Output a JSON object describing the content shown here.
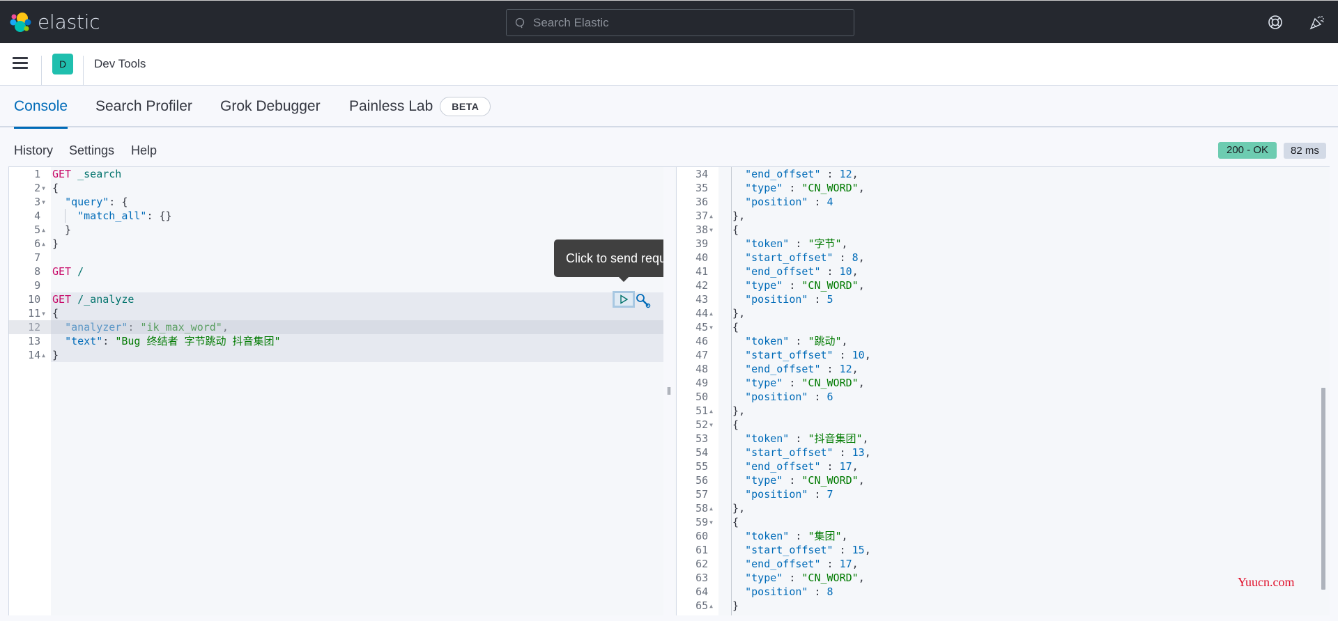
{
  "header": {
    "brand": "elastic",
    "search_placeholder": "Search Elastic",
    "icons": [
      "help-lifebuoy-icon",
      "newsfeed-party-icon"
    ]
  },
  "navbar": {
    "menu_icon": "hamburger-icon",
    "space_initial": "D",
    "app_title": "Dev Tools"
  },
  "tabs": [
    {
      "label": "Console",
      "active": true
    },
    {
      "label": "Search Profiler",
      "active": false
    },
    {
      "label": "Grok Debugger",
      "active": false
    },
    {
      "label": "Painless Lab",
      "active": false,
      "badge": "BETA"
    }
  ],
  "console_toolbar": {
    "history": "History",
    "settings": "Settings",
    "help": "Help",
    "status": "200 - OK",
    "status_color": "#6dccb1",
    "time": "82 ms"
  },
  "tooltip": "Click to send request",
  "editor": {
    "lines": [
      {
        "n": "1",
        "fold": "",
        "tokens": [
          [
            "kw",
            "GET"
          ],
          [
            "pun",
            " "
          ],
          [
            "url",
            "_search"
          ]
        ]
      },
      {
        "n": "2",
        "fold": "down",
        "tokens": [
          [
            "pun",
            "{"
          ]
        ]
      },
      {
        "n": "3",
        "fold": "down",
        "tokens": [
          [
            "pun",
            "  "
          ],
          [
            "key",
            "\"query\""
          ],
          [
            "pun",
            ": {"
          ]
        ]
      },
      {
        "n": "4",
        "fold": "",
        "tokens": [
          [
            "pun",
            "    "
          ],
          [
            "key",
            "\"match_all\""
          ],
          [
            "pun",
            ": {}"
          ]
        ]
      },
      {
        "n": "5",
        "fold": "up",
        "tokens": [
          [
            "pun",
            "  }"
          ]
        ]
      },
      {
        "n": "6",
        "fold": "up",
        "tokens": [
          [
            "pun",
            "}"
          ]
        ]
      },
      {
        "n": "7",
        "fold": "",
        "tokens": []
      },
      {
        "n": "8",
        "fold": "",
        "tokens": [
          [
            "kw",
            "GET"
          ],
          [
            "pun",
            " "
          ],
          [
            "url",
            "/"
          ]
        ]
      },
      {
        "n": "9",
        "fold": "",
        "tokens": []
      },
      {
        "n": "10",
        "fold": "",
        "tokens": [
          [
            "kw",
            "GET"
          ],
          [
            "pun",
            " "
          ],
          [
            "url",
            "/_analyze"
          ]
        ]
      },
      {
        "n": "11",
        "fold": "down",
        "tokens": [
          [
            "pun",
            "{"
          ]
        ]
      },
      {
        "n": "12",
        "fold": "",
        "tokens": [
          [
            "pun",
            "  "
          ],
          [
            "key",
            "\"analyzer\""
          ],
          [
            "pun",
            ": "
          ],
          [
            "str",
            "\"ik_max_word\""
          ],
          [
            "pun",
            ","
          ]
        ]
      },
      {
        "n": "13",
        "fold": "",
        "tokens": [
          [
            "pun",
            "  "
          ],
          [
            "key",
            "\"text\""
          ],
          [
            "pun",
            ": "
          ],
          [
            "str",
            "\"Bug 终结者 字节跳动 抖音集团\""
          ]
        ]
      },
      {
        "n": "14",
        "fold": "up",
        "tokens": [
          [
            "pun",
            "}"
          ]
        ]
      }
    ]
  },
  "output": {
    "lines": [
      {
        "n": "34",
        "fold": "",
        "tokens": [
          [
            "pun",
            "    "
          ],
          [
            "key",
            "\"end_offset\""
          ],
          [
            "pun",
            " : "
          ],
          [
            "num",
            "12"
          ],
          [
            "pun",
            ","
          ]
        ]
      },
      {
        "n": "35",
        "fold": "",
        "tokens": [
          [
            "pun",
            "    "
          ],
          [
            "key",
            "\"type\""
          ],
          [
            "pun",
            " : "
          ],
          [
            "str",
            "\"CN_WORD\""
          ],
          [
            "pun",
            ","
          ]
        ]
      },
      {
        "n": "36",
        "fold": "",
        "tokens": [
          [
            "pun",
            "    "
          ],
          [
            "key",
            "\"position\""
          ],
          [
            "pun",
            " : "
          ],
          [
            "num",
            "4"
          ]
        ]
      },
      {
        "n": "37",
        "fold": "up",
        "tokens": [
          [
            "pun",
            "  },"
          ]
        ]
      },
      {
        "n": "38",
        "fold": "down",
        "tokens": [
          [
            "pun",
            "  {"
          ]
        ]
      },
      {
        "n": "39",
        "fold": "",
        "tokens": [
          [
            "pun",
            "    "
          ],
          [
            "key",
            "\"token\""
          ],
          [
            "pun",
            " : "
          ],
          [
            "str",
            "\"字节\""
          ],
          [
            "pun",
            ","
          ]
        ]
      },
      {
        "n": "40",
        "fold": "",
        "tokens": [
          [
            "pun",
            "    "
          ],
          [
            "key",
            "\"start_offset\""
          ],
          [
            "pun",
            " : "
          ],
          [
            "num",
            "8"
          ],
          [
            "pun",
            ","
          ]
        ]
      },
      {
        "n": "41",
        "fold": "",
        "tokens": [
          [
            "pun",
            "    "
          ],
          [
            "key",
            "\"end_offset\""
          ],
          [
            "pun",
            " : "
          ],
          [
            "num",
            "10"
          ],
          [
            "pun",
            ","
          ]
        ]
      },
      {
        "n": "42",
        "fold": "",
        "tokens": [
          [
            "pun",
            "    "
          ],
          [
            "key",
            "\"type\""
          ],
          [
            "pun",
            " : "
          ],
          [
            "str",
            "\"CN_WORD\""
          ],
          [
            "pun",
            ","
          ]
        ]
      },
      {
        "n": "43",
        "fold": "",
        "tokens": [
          [
            "pun",
            "    "
          ],
          [
            "key",
            "\"position\""
          ],
          [
            "pun",
            " : "
          ],
          [
            "num",
            "5"
          ]
        ]
      },
      {
        "n": "44",
        "fold": "up",
        "tokens": [
          [
            "pun",
            "  },"
          ]
        ]
      },
      {
        "n": "45",
        "fold": "down",
        "tokens": [
          [
            "pun",
            "  {"
          ]
        ]
      },
      {
        "n": "46",
        "fold": "",
        "tokens": [
          [
            "pun",
            "    "
          ],
          [
            "key",
            "\"token\""
          ],
          [
            "pun",
            " : "
          ],
          [
            "str",
            "\"跳动\""
          ],
          [
            "pun",
            ","
          ]
        ]
      },
      {
        "n": "47",
        "fold": "",
        "tokens": [
          [
            "pun",
            "    "
          ],
          [
            "key",
            "\"start_offset\""
          ],
          [
            "pun",
            " : "
          ],
          [
            "num",
            "10"
          ],
          [
            "pun",
            ","
          ]
        ]
      },
      {
        "n": "48",
        "fold": "",
        "tokens": [
          [
            "pun",
            "    "
          ],
          [
            "key",
            "\"end_offset\""
          ],
          [
            "pun",
            " : "
          ],
          [
            "num",
            "12"
          ],
          [
            "pun",
            ","
          ]
        ]
      },
      {
        "n": "49",
        "fold": "",
        "tokens": [
          [
            "pun",
            "    "
          ],
          [
            "key",
            "\"type\""
          ],
          [
            "pun",
            " : "
          ],
          [
            "str",
            "\"CN_WORD\""
          ],
          [
            "pun",
            ","
          ]
        ]
      },
      {
        "n": "50",
        "fold": "",
        "tokens": [
          [
            "pun",
            "    "
          ],
          [
            "key",
            "\"position\""
          ],
          [
            "pun",
            " : "
          ],
          [
            "num",
            "6"
          ]
        ]
      },
      {
        "n": "51",
        "fold": "up",
        "tokens": [
          [
            "pun",
            "  },"
          ]
        ]
      },
      {
        "n": "52",
        "fold": "down",
        "tokens": [
          [
            "pun",
            "  {"
          ]
        ]
      },
      {
        "n": "53",
        "fold": "",
        "tokens": [
          [
            "pun",
            "    "
          ],
          [
            "key",
            "\"token\""
          ],
          [
            "pun",
            " : "
          ],
          [
            "str",
            "\"抖音集团\""
          ],
          [
            "pun",
            ","
          ]
        ]
      },
      {
        "n": "54",
        "fold": "",
        "tokens": [
          [
            "pun",
            "    "
          ],
          [
            "key",
            "\"start_offset\""
          ],
          [
            "pun",
            " : "
          ],
          [
            "num",
            "13"
          ],
          [
            "pun",
            ","
          ]
        ]
      },
      {
        "n": "55",
        "fold": "",
        "tokens": [
          [
            "pun",
            "    "
          ],
          [
            "key",
            "\"end_offset\""
          ],
          [
            "pun",
            " : "
          ],
          [
            "num",
            "17"
          ],
          [
            "pun",
            ","
          ]
        ]
      },
      {
        "n": "56",
        "fold": "",
        "tokens": [
          [
            "pun",
            "    "
          ],
          [
            "key",
            "\"type\""
          ],
          [
            "pun",
            " : "
          ],
          [
            "str",
            "\"CN_WORD\""
          ],
          [
            "pun",
            ","
          ]
        ]
      },
      {
        "n": "57",
        "fold": "",
        "tokens": [
          [
            "pun",
            "    "
          ],
          [
            "key",
            "\"position\""
          ],
          [
            "pun",
            " : "
          ],
          [
            "num",
            "7"
          ]
        ]
      },
      {
        "n": "58",
        "fold": "up",
        "tokens": [
          [
            "pun",
            "  },"
          ]
        ]
      },
      {
        "n": "59",
        "fold": "down",
        "tokens": [
          [
            "pun",
            "  {"
          ]
        ]
      },
      {
        "n": "60",
        "fold": "",
        "tokens": [
          [
            "pun",
            "    "
          ],
          [
            "key",
            "\"token\""
          ],
          [
            "pun",
            " : "
          ],
          [
            "str",
            "\"集团\""
          ],
          [
            "pun",
            ","
          ]
        ]
      },
      {
        "n": "61",
        "fold": "",
        "tokens": [
          [
            "pun",
            "    "
          ],
          [
            "key",
            "\"start_offset\""
          ],
          [
            "pun",
            " : "
          ],
          [
            "num",
            "15"
          ],
          [
            "pun",
            ","
          ]
        ]
      },
      {
        "n": "62",
        "fold": "",
        "tokens": [
          [
            "pun",
            "    "
          ],
          [
            "key",
            "\"end_offset\""
          ],
          [
            "pun",
            " : "
          ],
          [
            "num",
            "17"
          ],
          [
            "pun",
            ","
          ]
        ]
      },
      {
        "n": "63",
        "fold": "",
        "tokens": [
          [
            "pun",
            "    "
          ],
          [
            "key",
            "\"type\""
          ],
          [
            "pun",
            " : "
          ],
          [
            "str",
            "\"CN_WORD\""
          ],
          [
            "pun",
            ","
          ]
        ]
      },
      {
        "n": "64",
        "fold": "",
        "tokens": [
          [
            "pun",
            "    "
          ],
          [
            "key",
            "\"position\""
          ],
          [
            "pun",
            " : "
          ],
          [
            "num",
            "8"
          ]
        ]
      },
      {
        "n": "65",
        "fold": "up",
        "tokens": [
          [
            "pun",
            "  }"
          ]
        ]
      }
    ]
  },
  "watermark": "Yuucn.com"
}
